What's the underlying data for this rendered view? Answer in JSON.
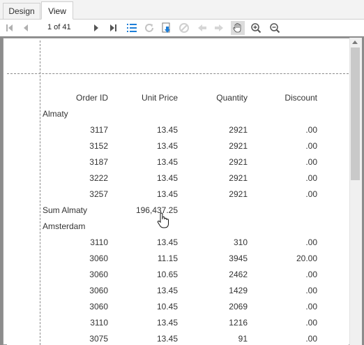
{
  "tabs": {
    "design": "Design",
    "view": "View"
  },
  "toolbar": {
    "page_info": "1 of 41",
    "icons": [
      "first-page-icon",
      "prev-page-icon",
      "next-page-icon",
      "last-page-icon",
      "toc-list-icon",
      "refresh-icon",
      "export-icon",
      "stop-icon",
      "back-icon",
      "forward-icon",
      "hand-pan-icon",
      "zoom-in-icon",
      "zoom-out-icon"
    ]
  },
  "report": {
    "headers": {
      "order_id": "Order ID",
      "unit_price": "Unit Price",
      "quantity": "Quantity",
      "discount": "Discount"
    },
    "groups": [
      {
        "name": "Almaty",
        "rows": [
          {
            "id": "3117",
            "price": "13.45",
            "qty": "2921",
            "disc": ".00"
          },
          {
            "id": "3152",
            "price": "13.45",
            "qty": "2921",
            "disc": ".00"
          },
          {
            "id": "3187",
            "price": "13.45",
            "qty": "2921",
            "disc": ".00"
          },
          {
            "id": "3222",
            "price": "13.45",
            "qty": "2921",
            "disc": ".00"
          },
          {
            "id": "3257",
            "price": "13.45",
            "qty": "2921",
            "disc": ".00"
          }
        ],
        "sum_label": "Sum Almaty",
        "sum_value": "196,437.25"
      },
      {
        "name": "Amsterdam",
        "rows": [
          {
            "id": "3110",
            "price": "13.45",
            "qty": "310",
            "disc": ".00"
          },
          {
            "id": "3060",
            "price": "11.15",
            "qty": "3945",
            "disc": "20.00"
          },
          {
            "id": "3060",
            "price": "10.65",
            "qty": "2462",
            "disc": ".00"
          },
          {
            "id": "3060",
            "price": "13.45",
            "qty": "1429",
            "disc": ".00"
          },
          {
            "id": "3060",
            "price": "10.45",
            "qty": "2069",
            "disc": ".00"
          },
          {
            "id": "3110",
            "price": "13.45",
            "qty": "1216",
            "disc": ".00"
          },
          {
            "id": "3075",
            "price": "13.45",
            "qty": "91",
            "disc": ".00"
          }
        ]
      }
    ]
  }
}
